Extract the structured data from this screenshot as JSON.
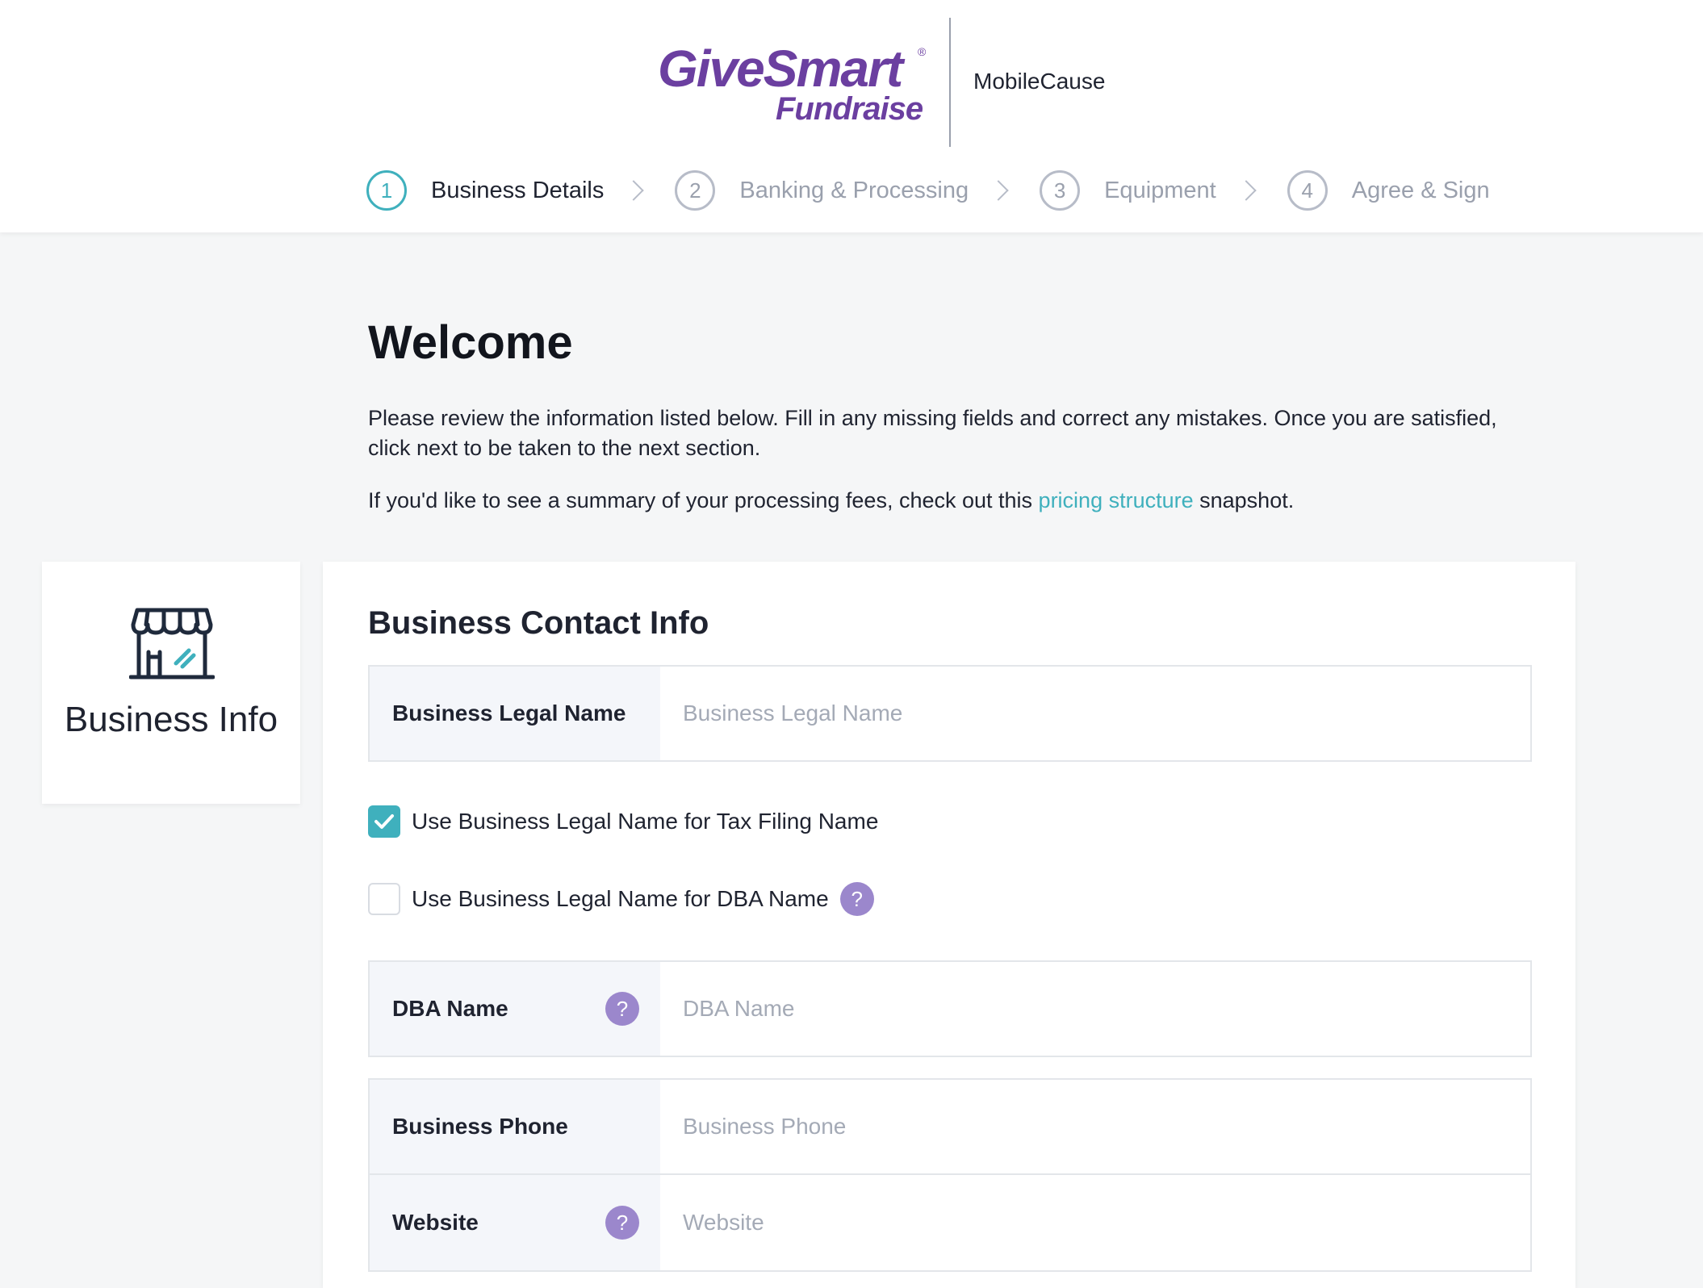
{
  "brand": {
    "logo_main": "GiveSmart",
    "logo_registered": "®",
    "logo_sub": "Fundraise",
    "partner": "MobileCause",
    "primary_color": "#6b3fa0",
    "accent_color": "#3fb0bd",
    "help_color": "#9b87cc"
  },
  "steps": [
    {
      "num": "1",
      "label": "Business Details",
      "active": true
    },
    {
      "num": "2",
      "label": "Banking & Processing",
      "active": false
    },
    {
      "num": "3",
      "label": "Equipment",
      "active": false
    },
    {
      "num": "4",
      "label": "Agree & Sign",
      "active": false
    }
  ],
  "intro": {
    "title": "Welcome",
    "paragraph1": "Please review the information listed below. Fill in any missing fields and correct any mistakes. Once you are satisfied, click next to be taken to the next section.",
    "paragraph2_before": "If you'd like to see a summary of your processing fees, check out this ",
    "paragraph2_link": "pricing structure",
    "paragraph2_after": " snapshot."
  },
  "side_card": {
    "icon": "storefront-icon",
    "title": "Business Info"
  },
  "form": {
    "title": "Business Contact Info",
    "legal_name": {
      "label": "Business Legal Name",
      "placeholder": "Business Legal Name",
      "value": ""
    },
    "tax_checkbox": {
      "label": "Use Business Legal Name for Tax Filing Name",
      "checked": true
    },
    "dba_checkbox": {
      "label": "Use Business Legal Name for DBA Name",
      "checked": false,
      "help": "?"
    },
    "dba_name": {
      "label": "DBA Name",
      "placeholder": "DBA Name",
      "value": "",
      "help": "?"
    },
    "phone": {
      "label": "Business Phone",
      "placeholder": "Business Phone",
      "value": ""
    },
    "website": {
      "label": "Website",
      "placeholder": "Website",
      "value": "",
      "help": "?"
    }
  }
}
